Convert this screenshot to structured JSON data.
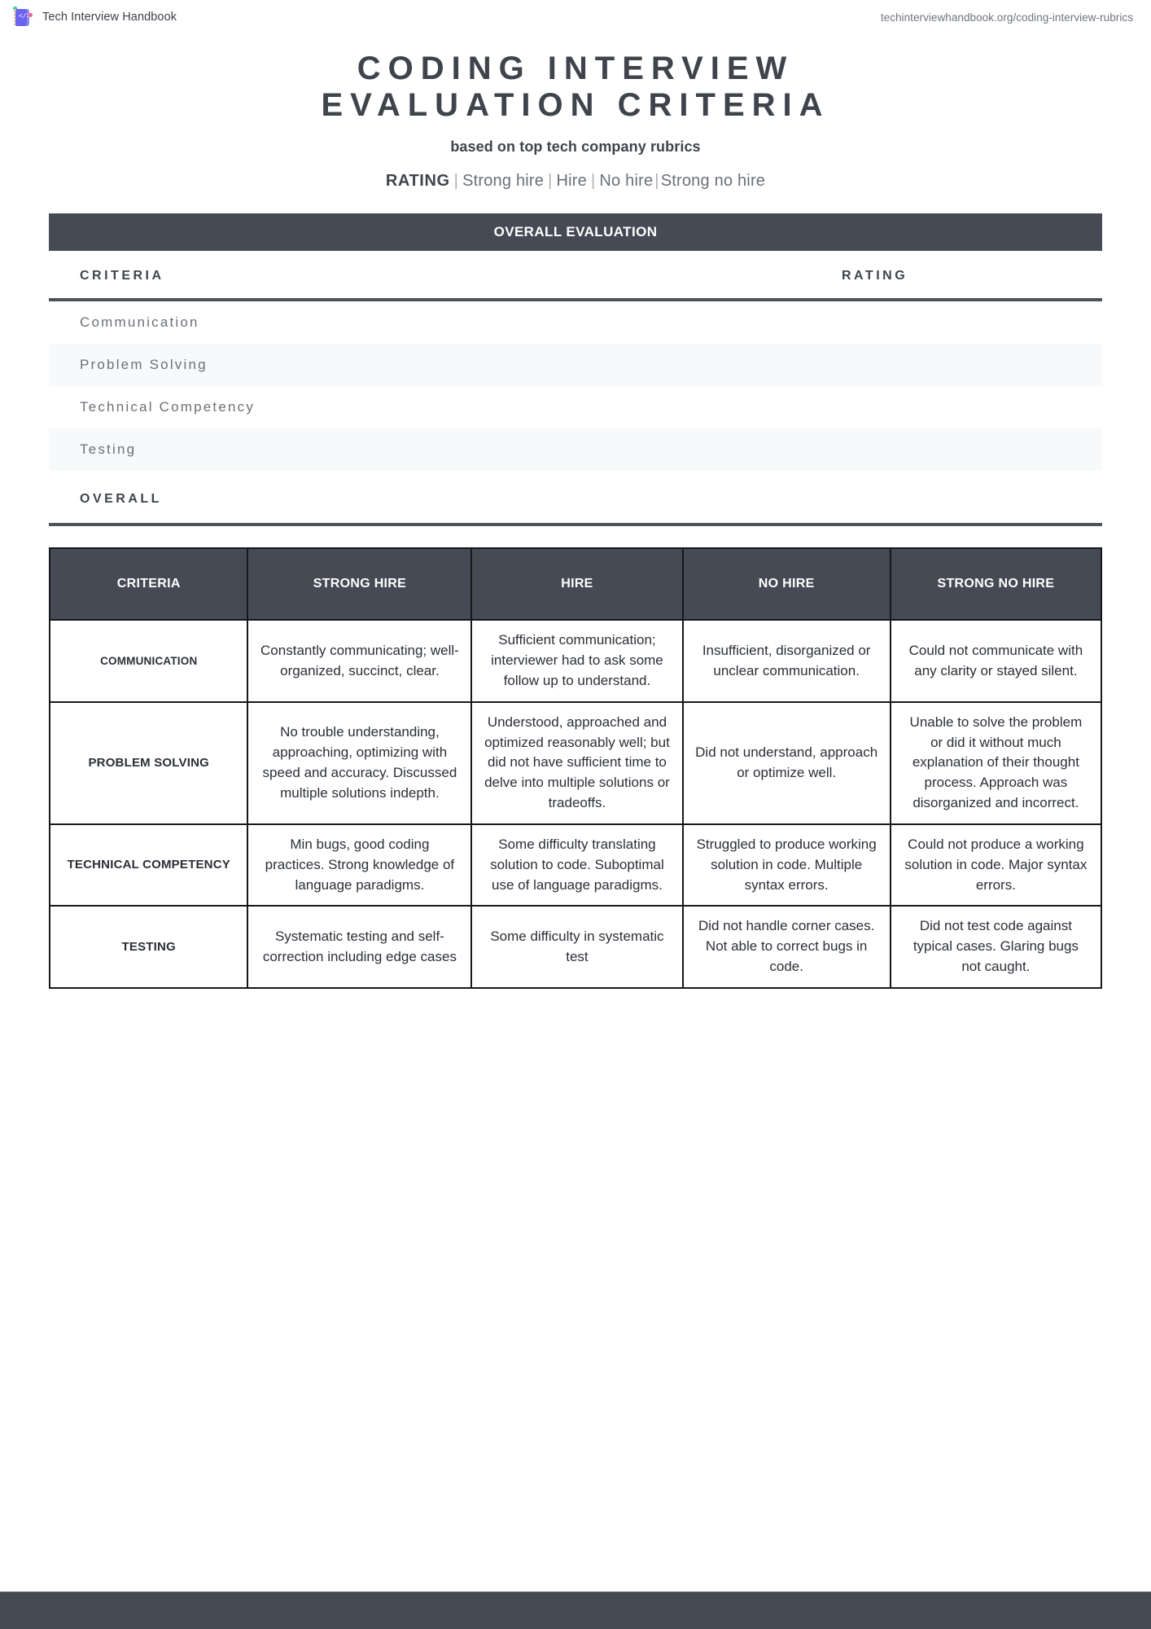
{
  "topbar": {
    "brand_name": "Tech Interview Handbook",
    "logo_glyph": "</>",
    "url": "techinterviewhandbook.org/coding-interview-rubrics"
  },
  "header": {
    "title": "CODING INTERVIEW\nEVALUATION CRITERIA",
    "subtitle": "based on top tech company rubrics",
    "rating_label": "RATING",
    "rating_options": [
      "Strong hire",
      "Hire",
      "No hire",
      "Strong no hire"
    ]
  },
  "overall_evaluation": {
    "band_title": "OVERALL EVALUATION",
    "columns": [
      "CRITERIA",
      "RATING"
    ],
    "rows": [
      {
        "criteria": "Communication",
        "rating": ""
      },
      {
        "criteria": "Problem Solving",
        "rating": ""
      },
      {
        "criteria": "Technical Competency",
        "rating": ""
      },
      {
        "criteria": "Testing",
        "rating": ""
      }
    ],
    "overall_label": "OVERALL",
    "overall_rating": ""
  },
  "rubric": {
    "columns": [
      "CRITERIA",
      "STRONG HIRE",
      "HIRE",
      "NO HIRE",
      "STRONG NO HIRE"
    ],
    "rows": [
      {
        "criteria": "COMMUNICATION",
        "strong_hire": "Constantly communicating; well-organized, succinct, clear.",
        "hire": "Sufficient communication; interviewer had to ask some follow up to understand.",
        "no_hire": "Insufficient, disorganized or unclear communication.",
        "strong_no_hire": "Could not communicate with any clarity or stayed silent."
      },
      {
        "criteria": "PROBLEM SOLVING",
        "strong_hire": "No trouble understanding, approaching, optimizing with speed and accuracy. Discussed multiple solutions indepth.",
        "hire": "Understood, approached and optimized reasonably well; but did not have sufficient time to delve into multiple solutions or tradeoffs.",
        "no_hire": "Did not understand, approach or optimize well.",
        "strong_no_hire": "Unable to solve the problem or did it without much explanation of their thought process. Approach was disorganized and incorrect."
      },
      {
        "criteria": "TECHNICAL COMPETENCY",
        "strong_hire": "Min bugs, good coding practices. Strong knowledge of language paradigms.",
        "hire": "Some difficulty translating solution to code. Suboptimal use of language paradigms.",
        "no_hire": "Struggled to produce working solution in code. Multiple syntax errors.",
        "strong_no_hire": "Could not produce a working solution in code. Major syntax errors."
      },
      {
        "criteria": "TESTING",
        "strong_hire": "Systematic testing and self-correction including edge cases",
        "hire": "Some difficulty in systematic test",
        "no_hire": "Did not handle corner cases. Not able to correct bugs in code.",
        "strong_no_hire": "Did not test code against typical cases. Glaring bugs not caught."
      }
    ]
  },
  "colors": {
    "dark": "#454a54",
    "text": "#3f444c",
    "muted": "#6b7077",
    "alt_row": "#f8f9fa",
    "brand_purple": "#6c63ef"
  }
}
